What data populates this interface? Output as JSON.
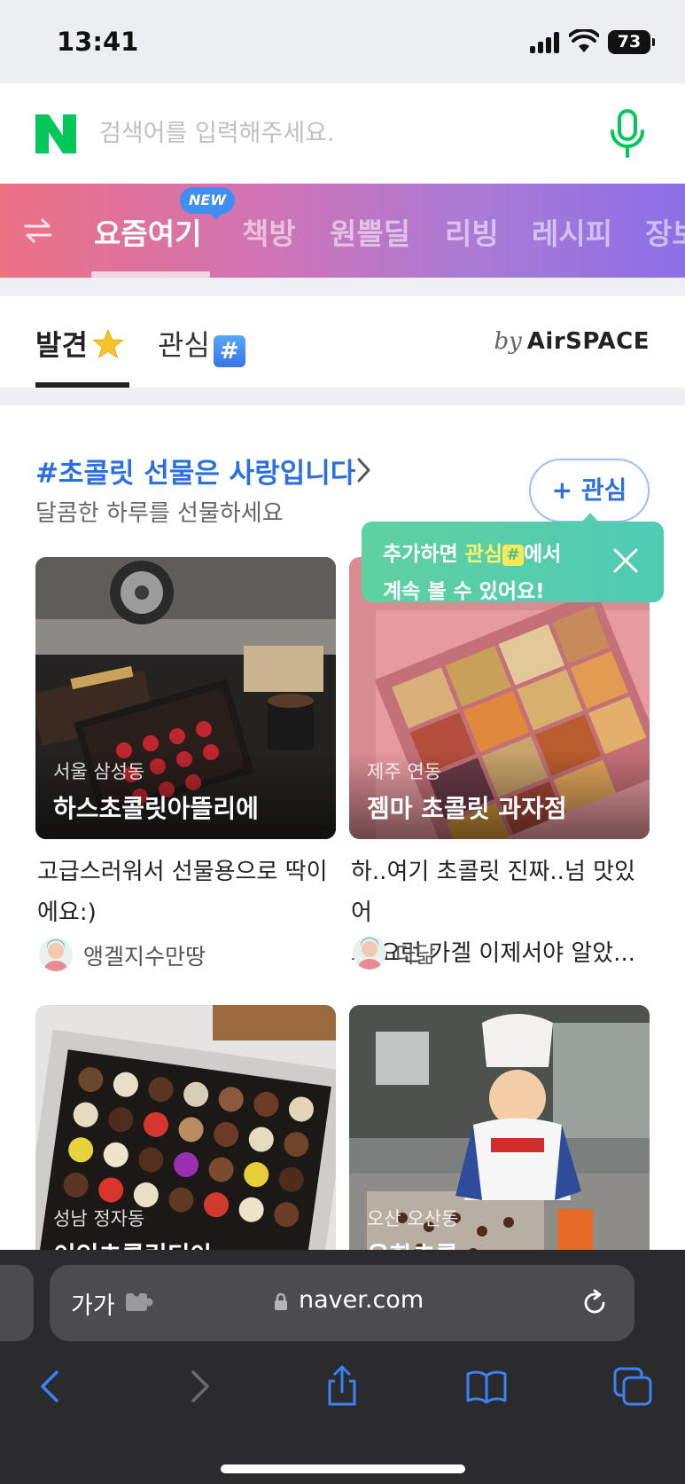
{
  "status_bar": {
    "time": "13:41",
    "battery": "73"
  },
  "search": {
    "placeholder": "검색어를 입력해주세요."
  },
  "category_tabs": {
    "new_badge": "NEW",
    "items": [
      {
        "label": "요즘여기",
        "active": true
      },
      {
        "label": "책방",
        "active": false
      },
      {
        "label": "원쁠딜",
        "active": false
      },
      {
        "label": "리빙",
        "active": false
      },
      {
        "label": "레시피",
        "active": false
      },
      {
        "label": "장보기",
        "active": false
      }
    ]
  },
  "sub_tabs": {
    "discover": "발견",
    "interest": "관심",
    "interest_hash": "#",
    "by": "by",
    "brand": "AirSPACE"
  },
  "section": {
    "title": "#초콜릿 선물은 사랑입니다",
    "subtitle": "달콤한 하루를 선물하세요",
    "follow_button": "+ 관심"
  },
  "tooltip": {
    "part1": "추가하면 ",
    "highlight": "관심",
    "hash": "#",
    "part2": "에서",
    "line2": "계속 볼 수 있어요!"
  },
  "cards": [
    {
      "location": "서울 삼성동",
      "store": "하스초콜릿아뜰리에",
      "desc_line1": "고급스러워서 선물용으로 딱이",
      "desc_line2": "에요:)",
      "author": "앵겔지수만땅"
    },
    {
      "location": "제주 연동",
      "store": "젬마 초콜릿 과자점",
      "desc_line1": "하..여기 초콜릿 진짜..넘 맛있어",
      "desc_line2": "요 요런 가겔 이제서야 알았...",
      "author": "다닮"
    },
    {
      "location": "성남 정자동",
      "store": "이인초콜릿디아"
    },
    {
      "location": "오산 오산동",
      "store": "유화초콜"
    }
  ],
  "browser": {
    "text_size": "가가",
    "url": "naver.com"
  },
  "colors": {
    "naver_green": "#03c75a",
    "section_blue": "#2b6fe0",
    "tooltip_green": "#58cfa6",
    "browser_chrome": "#2b2b2d",
    "toolbar_blue": "#3b82f6"
  },
  "icons": [
    "signal-icon",
    "wifi-icon",
    "mic-icon",
    "swap-icon",
    "star-icon",
    "hash-icon",
    "chevron-right-icon",
    "close-icon",
    "extension-icon",
    "lock-icon",
    "reload-icon",
    "back-icon",
    "forward-icon",
    "share-icon",
    "bookmarks-icon",
    "tabs-icon"
  ]
}
